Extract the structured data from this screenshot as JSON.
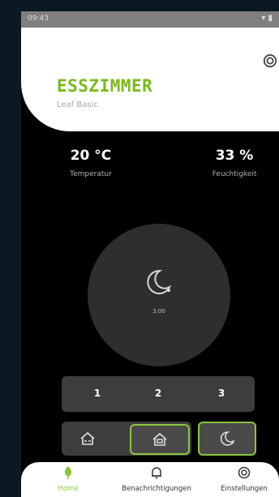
{
  "status_bar": {
    "time": "09:43",
    "icons": "▾ ▮"
  },
  "header": {
    "title": "ESSZIMMER",
    "subtitle": "Leaf Basic"
  },
  "stats": {
    "temperature": {
      "value": "20 °C",
      "label": "Temperatur"
    },
    "humidity": {
      "value": "33 %",
      "label": "Feuchtigkeit"
    }
  },
  "dial": {
    "icon": "moon-icon",
    "timer": "3:00"
  },
  "levels": [
    "1",
    "2",
    "3"
  ],
  "modes": {
    "selected": "home",
    "items": [
      "away-icon",
      "home-icon"
    ]
  },
  "night_mode": {
    "icon": "moon-icon",
    "active": true
  },
  "nav": {
    "home": "Home",
    "notifications": "Benachrichtigungen",
    "settings": "Einstellungen"
  },
  "colors": {
    "accent": "#8cc63f",
    "title": "#7ab81d",
    "background": "#000000"
  }
}
